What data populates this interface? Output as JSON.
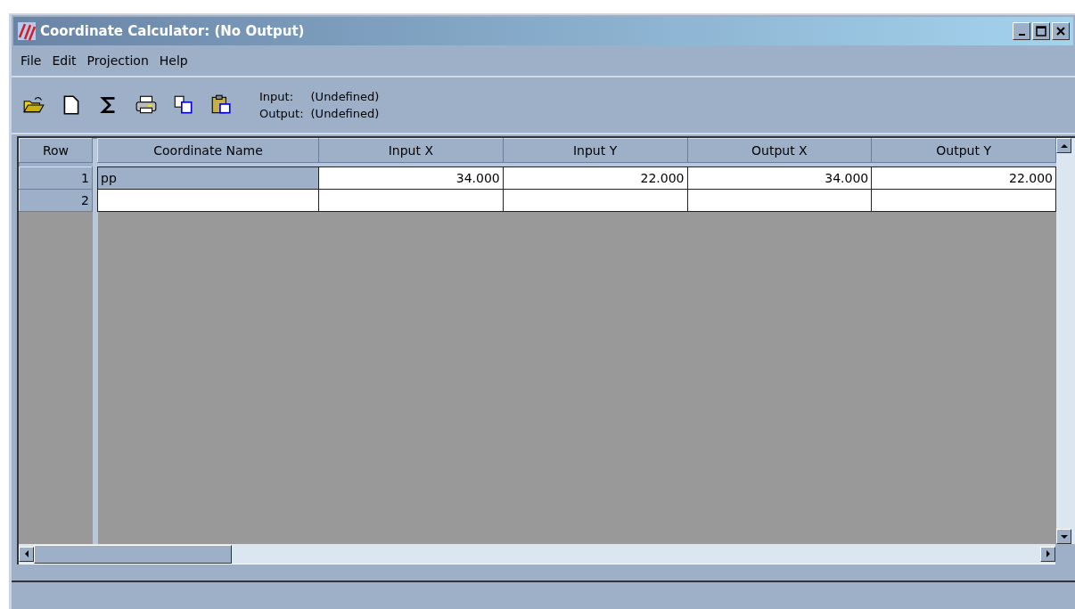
{
  "window": {
    "title": "Coordinate Calculator: (No Output)"
  },
  "menu": [
    "File",
    "Edit",
    "Projection",
    "Help"
  ],
  "toolbar": {
    "info": [
      {
        "label": "Input:",
        "value": "(Undefined)"
      },
      {
        "label": "Output:",
        "value": "(Undefined)"
      }
    ]
  },
  "table": {
    "row_header": "Row",
    "columns": [
      "Coordinate Name",
      "Input X",
      "Input Y",
      "Output X",
      "Output Y"
    ],
    "rows": [
      {
        "row": "1",
        "selected": true,
        "cells": [
          "pp",
          "34.000",
          "22.000",
          "34.000",
          "22.000"
        ]
      },
      {
        "row": "2",
        "selected": false,
        "cells": []
      }
    ]
  }
}
